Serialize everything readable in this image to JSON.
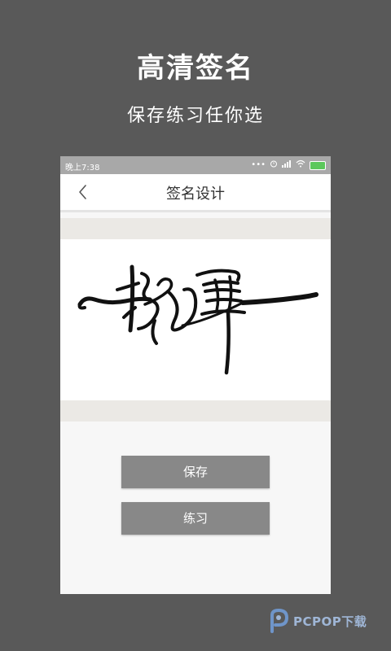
{
  "promo": {
    "title": "高清签名",
    "subtitle": "保存练习任你选"
  },
  "status_bar": {
    "time": "晚上7:38",
    "icons": [
      "more-dots-icon",
      "alarm-icon",
      "signal-icon",
      "wifi-icon",
      "battery-icon"
    ],
    "battery_color": "#5cc85c"
  },
  "app_bar": {
    "back_icon": "chevron-left-icon",
    "title": "签名设计"
  },
  "buttons": {
    "save_label": "保存",
    "practice_label": "练习"
  },
  "watermark": {
    "text": "PCPOP下载",
    "color": "#9fb6d6"
  },
  "colors": {
    "background": "#595959",
    "button": "#888888",
    "status_bar": "#a8a8a8"
  }
}
